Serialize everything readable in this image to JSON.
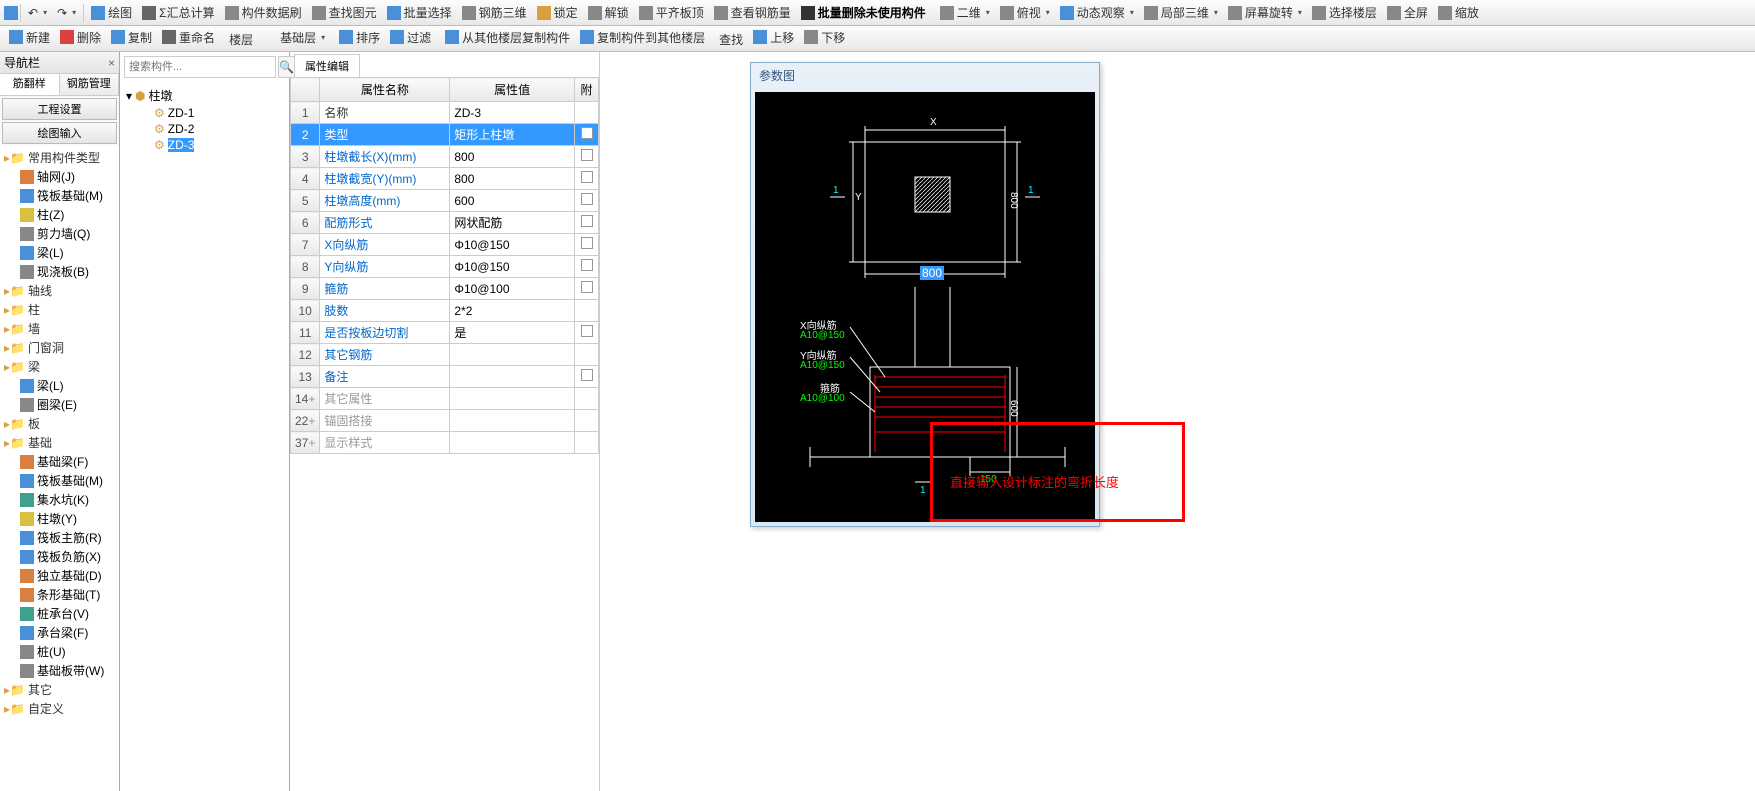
{
  "toolbar1": {
    "items": [
      {
        "label": "绘图",
        "icon": "#4a90d9"
      },
      {
        "label": "汇总计算",
        "icon": "#666",
        "prefix": "Σ"
      },
      {
        "label": "构件数据刷",
        "icon": "#888"
      },
      {
        "label": "查找图元",
        "icon": "#888"
      },
      {
        "label": "批量选择",
        "icon": "#4a90d9"
      },
      {
        "label": "钢筋三维",
        "icon": "#888"
      },
      {
        "label": "锁定",
        "icon": "#d9a040"
      },
      {
        "label": "解锁",
        "icon": "#888"
      },
      {
        "label": "平齐板顶",
        "icon": "#888"
      },
      {
        "label": "查看钢筋量",
        "icon": "#888"
      },
      {
        "label": "批量删除未使用构件",
        "icon": "#333",
        "bold": true
      },
      {
        "label": "二维",
        "icon": "#888"
      },
      {
        "label": "俯视",
        "icon": "#888"
      },
      {
        "label": "动态观察",
        "icon": "#4a90d9"
      },
      {
        "label": "局部三维",
        "icon": "#888"
      },
      {
        "label": "屏幕旋转",
        "icon": "#888"
      },
      {
        "label": "选择楼层",
        "icon": "#888"
      },
      {
        "label": "全屏",
        "icon": "#888"
      },
      {
        "label": "缩放",
        "icon": "#888"
      }
    ]
  },
  "toolbar2": {
    "items": [
      {
        "label": "新建",
        "icon": "#4a90d9"
      },
      {
        "label": "删除",
        "icon": "#d94040"
      },
      {
        "label": "复制",
        "icon": "#4a90d9"
      },
      {
        "label": "重命名",
        "icon": "#666"
      },
      {
        "label": "楼层",
        "plain": true
      },
      {
        "label": "基础层",
        "dropdown": true
      },
      {
        "label": "排序",
        "icon": "#4a90d9"
      },
      {
        "label": "过滤",
        "icon": "#4a90d9"
      },
      {
        "label": "从其他楼层复制构件",
        "icon": "#4a90d9"
      },
      {
        "label": "复制构件到其他楼层",
        "icon": "#4a90d9"
      },
      {
        "label": "查找",
        "plain": true
      },
      {
        "label": "上移",
        "icon": "#4a90d9"
      },
      {
        "label": "下移",
        "icon": "#888"
      }
    ]
  },
  "leftPanel": {
    "header": "导航栏",
    "tabs": [
      "筋翻样",
      "钢筋管理"
    ],
    "buttons": [
      "工程设置",
      "绘图输入"
    ],
    "tree": [
      {
        "label": "常用构件类型",
        "children": [
          {
            "label": "轴网(J)",
            "icon": "#d98040"
          },
          {
            "label": "筏板基础(M)",
            "icon": "#4a90d9"
          },
          {
            "label": "柱(Z)",
            "icon": "#d9c040"
          },
          {
            "label": "剪力墙(Q)",
            "icon": "#888"
          },
          {
            "label": "梁(L)",
            "icon": "#4a90d9"
          },
          {
            "label": "现浇板(B)",
            "icon": "#888"
          }
        ]
      },
      {
        "label": "轴线",
        "children": []
      },
      {
        "label": "柱",
        "children": []
      },
      {
        "label": "墙",
        "children": []
      },
      {
        "label": "门窗洞",
        "children": []
      },
      {
        "label": "梁",
        "children": [
          {
            "label": "梁(L)",
            "icon": "#4a90d9"
          },
          {
            "label": "圈梁(E)",
            "icon": "#888"
          }
        ]
      },
      {
        "label": "板",
        "children": []
      },
      {
        "label": "基础",
        "children": [
          {
            "label": "基础梁(F)",
            "icon": "#d98040"
          },
          {
            "label": "筏板基础(M)",
            "icon": "#4a90d9"
          },
          {
            "label": "集水坑(K)",
            "icon": "#40a090"
          },
          {
            "label": "柱墩(Y)",
            "icon": "#d9c040"
          },
          {
            "label": "筏板主筋(R)",
            "icon": "#4a90d9"
          },
          {
            "label": "筏板负筋(X)",
            "icon": "#4a90d9"
          },
          {
            "label": "独立基础(D)",
            "icon": "#d98040"
          },
          {
            "label": "条形基础(T)",
            "icon": "#d98040"
          },
          {
            "label": "桩承台(V)",
            "icon": "#40a090"
          },
          {
            "label": "承台梁(F)",
            "icon": "#4a90d9"
          },
          {
            "label": "桩(U)",
            "icon": "#888"
          },
          {
            "label": "基础板带(W)",
            "icon": "#888"
          }
        ]
      },
      {
        "label": "其它",
        "children": []
      },
      {
        "label": "自定义",
        "children": []
      }
    ]
  },
  "midPanel": {
    "searchPlaceholder": "搜索构件...",
    "root": "柱墩",
    "items": [
      "ZD-1",
      "ZD-2",
      "ZD-3"
    ],
    "selected": "ZD-3"
  },
  "propPanel": {
    "tab": "属性编辑",
    "headers": [
      "属性名称",
      "属性值",
      "附"
    ],
    "rows": [
      {
        "n": "1",
        "name": "名称",
        "val": "ZD-3",
        "link": false,
        "chk": false
      },
      {
        "n": "2",
        "name": "类型",
        "val": "矩形上柱墩",
        "link": true,
        "chk": true,
        "sel": true
      },
      {
        "n": "3",
        "name": "柱墩截长(X)(mm)",
        "val": "800",
        "link": true,
        "chk": true
      },
      {
        "n": "4",
        "name": "柱墩截宽(Y)(mm)",
        "val": "800",
        "link": true,
        "chk": true
      },
      {
        "n": "5",
        "name": "柱墩高度(mm)",
        "val": "600",
        "link": true,
        "chk": true
      },
      {
        "n": "6",
        "name": "配筋形式",
        "val": "网状配筋",
        "link": true,
        "chk": true
      },
      {
        "n": "7",
        "name": "X向纵筋",
        "val": "Φ10@150",
        "link": true,
        "chk": true
      },
      {
        "n": "8",
        "name": "Y向纵筋",
        "val": "Φ10@150",
        "link": true,
        "chk": true
      },
      {
        "n": "9",
        "name": "箍筋",
        "val": "Φ10@100",
        "link": true,
        "chk": true
      },
      {
        "n": "10",
        "name": "肢数",
        "val": "2*2",
        "link": true,
        "chk": false
      },
      {
        "n": "11",
        "name": "是否按板边切割",
        "val": "是",
        "link": true,
        "chk": true
      },
      {
        "n": "12",
        "name": "其它钢筋",
        "val": "",
        "link": true,
        "chk": false
      },
      {
        "n": "13",
        "name": "备注",
        "val": "",
        "link": true,
        "chk": true
      },
      {
        "n": "14",
        "name": "其它属性",
        "val": "",
        "expand": "+",
        "gray": true
      },
      {
        "n": "22",
        "name": "锚固搭接",
        "val": "",
        "expand": "+",
        "gray": true
      },
      {
        "n": "37",
        "name": "显示样式",
        "val": "",
        "expand": "+",
        "gray": true
      }
    ]
  },
  "paramPanel": {
    "title": "参数图",
    "topDims": {
      "X": "X",
      "Y": "Y",
      "one": "1",
      "val800": "800",
      "highlight": "800"
    },
    "labels": {
      "xrebar": "X向纵筋",
      "xrebarv": "A10@150",
      "yrebar": "Y向纵筋",
      "yrebarv": "A10@150",
      "hoop": "箍筋",
      "hoopv": "A10@100",
      "h600": "600",
      "d150": "150",
      "one": "1"
    },
    "annotation": "直接输入设计标注的弯折长度"
  }
}
